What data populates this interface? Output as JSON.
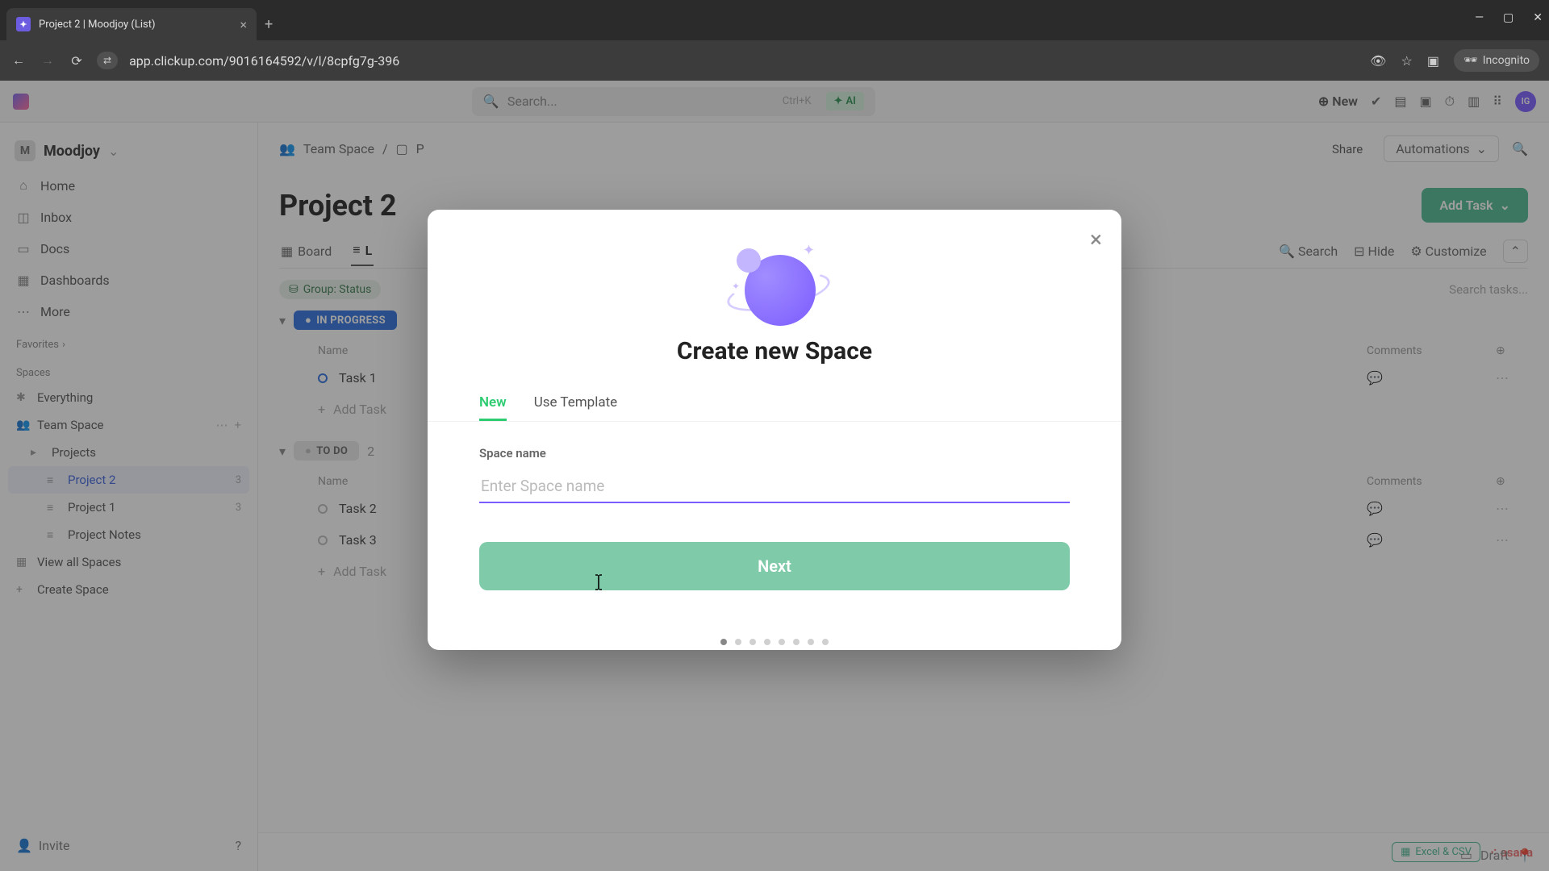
{
  "browser": {
    "tab_title": "Project 2 | Moodjoy (List)",
    "url": "app.clickup.com/9016164592/v/l/8cpfg7g-396",
    "incognito_label": "Incognito"
  },
  "header": {
    "search_placeholder": "Search...",
    "search_kbd": "Ctrl+K",
    "ai_label": "AI",
    "new_label": "New"
  },
  "workspace": {
    "initial": "M",
    "name": "Moodjoy"
  },
  "sidebar": {
    "nav": [
      {
        "label": "Home"
      },
      {
        "label": "Inbox"
      },
      {
        "label": "Docs"
      },
      {
        "label": "Dashboards"
      },
      {
        "label": "More"
      }
    ],
    "favorites_label": "Favorites",
    "spaces_label": "Spaces",
    "everything_label": "Everything",
    "team_space_label": "Team Space",
    "projects_label": "Projects",
    "project2": {
      "label": "Project 2",
      "count": "3"
    },
    "project1": {
      "label": "Project 1",
      "count": "3"
    },
    "project_notes_label": "Project Notes",
    "view_all_label": "View all Spaces",
    "create_space_label": "Create Space",
    "invite_label": "Invite"
  },
  "breadcrumb": {
    "space": "Team Space",
    "folder_prefix": "P"
  },
  "toolbar": {
    "share_label": "Share",
    "automations_label": "Automations"
  },
  "page": {
    "title": "Project 2",
    "add_task_label": "Add Task"
  },
  "views": {
    "board": "Board",
    "list_prefix": "L",
    "search": "Search",
    "hide": "Hide",
    "customize": "Customize"
  },
  "filters": {
    "group_label": "Group: Status",
    "search_tasks_placeholder": "Search tasks..."
  },
  "groups": {
    "in_progress": {
      "label": "IN PROGRESS",
      "col_name": "Name",
      "col_comments": "Comments",
      "tasks": [
        "Task 1"
      ],
      "add_task": "Add Task"
    },
    "todo": {
      "label": "TO DO",
      "count": "2",
      "col_name": "Name",
      "col_comments": "Comments",
      "tasks": [
        "Task 2",
        "Task 3"
      ],
      "add_task": "Add Task"
    }
  },
  "footer": {
    "excel_label": "Excel & CSV",
    "asana_label": "asana",
    "draft_label": "Draft"
  },
  "modal": {
    "title": "Create new Space",
    "tab_new": "New",
    "tab_template": "Use Template",
    "field_label": "Space name",
    "input_placeholder": "Enter Space name",
    "input_value": "",
    "next_label": "Next",
    "step_count": 8,
    "active_step": 0
  }
}
